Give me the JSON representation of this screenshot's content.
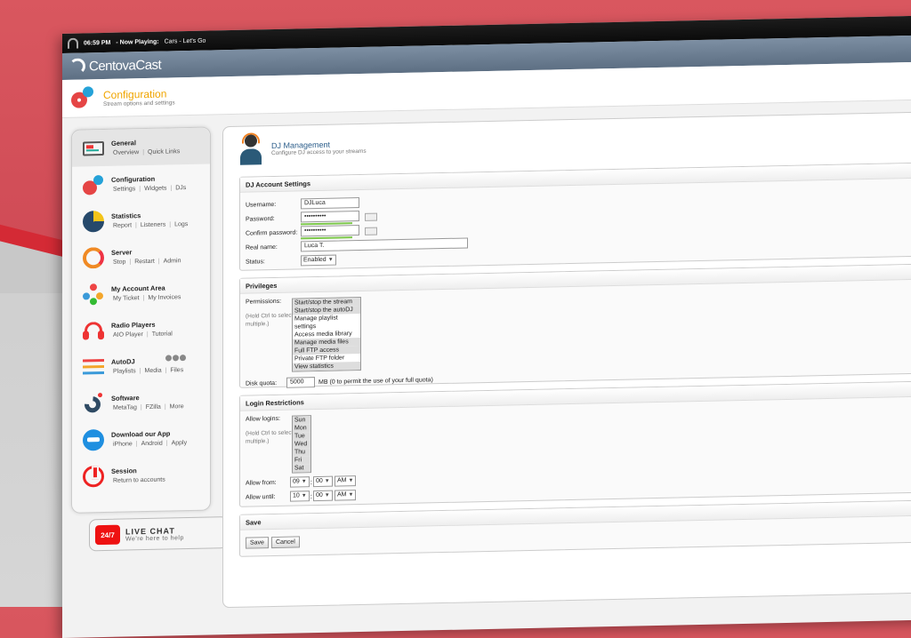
{
  "topbar": {
    "time": "06:59 PM",
    "now_playing_label": "- Now Playing:",
    "song": "Cars - Let's Go"
  },
  "brand": {
    "name": "CentovaCast"
  },
  "page": {
    "title": "Configuration",
    "subtitle": "Stream options and settings"
  },
  "sidebar": {
    "items": [
      {
        "title": "General",
        "links": [
          "Overview",
          "Quick Links"
        ],
        "icon": "monitor-icon"
      },
      {
        "title": "Configuration",
        "links": [
          "Settings",
          "Widgets",
          "DJs"
        ],
        "icon": "gears-icon"
      },
      {
        "title": "Statistics",
        "links": [
          "Report",
          "Listeners",
          "Logs"
        ],
        "icon": "pie-chart-icon"
      },
      {
        "title": "Server",
        "links": [
          "Stop",
          "Restart",
          "Admin"
        ],
        "icon": "refresh-icon"
      },
      {
        "title": "My Account Area",
        "links": [
          "My Ticket",
          "My Invoices"
        ],
        "icon": "users-icon"
      },
      {
        "title": "Radio Players",
        "links": [
          "AIO Player",
          "Tutorial"
        ],
        "icon": "headphones-icon"
      },
      {
        "title": "AutoDJ",
        "links": [
          "Playlists",
          "Media",
          "Files"
        ],
        "icon": "sliders-icon"
      },
      {
        "title": "Software",
        "links": [
          "MetaTag",
          "FZilla",
          "More"
        ],
        "icon": "magnet-icon"
      },
      {
        "title": "Download our App",
        "links": [
          "iPhone",
          "Android",
          "Apply"
        ],
        "icon": "app-icon"
      },
      {
        "title": "Session",
        "links": [
          "Return to accounts"
        ],
        "icon": "power-icon"
      }
    ]
  },
  "livechat": {
    "title": "LIVE CHAT",
    "subtitle": "We're here to help",
    "badge": "24/7"
  },
  "main": {
    "title": "DJ Management",
    "subtitle": "Configure DJ access to your streams"
  },
  "account": {
    "heading": "DJ Account Settings",
    "username_label": "Username:",
    "username": "DJLuca",
    "password_label": "Password:",
    "password": "••••••••••",
    "confirm_label": "Confirm password:",
    "confirm": "••••••••••",
    "realname_label": "Real name:",
    "realname": "Luca T.",
    "status_label": "Status:",
    "status": "Enabled"
  },
  "privileges": {
    "heading": "Privileges",
    "permissions_label": "Permissions:",
    "hint": "(Hold Ctrl to select multiple.)",
    "options": [
      "Start/stop the stream",
      "Start/stop the autoDJ",
      "Manage playlist settings",
      "Access media library",
      "Manage media files",
      "Full FTP access",
      "Private FTP folder",
      "View statistics"
    ],
    "disk_label": "Disk quota:",
    "disk_value": "5000",
    "disk_note": "MB (0 to permit the use of your full quota)"
  },
  "login": {
    "heading": "Login Restrictions",
    "allow_label": "Allow logins:",
    "hint": "(Hold Ctrl to select multiple.)",
    "days": [
      "Sun",
      "Mon",
      "Tue",
      "Wed",
      "Thu",
      "Fri",
      "Sat"
    ],
    "from_label": "Allow from:",
    "from_hour": "09",
    "from_min": "00",
    "from_ampm": "AM",
    "until_label": "Allow until:",
    "until_hour": "10",
    "until_min": "00",
    "until_ampm": "AM"
  },
  "save": {
    "heading": "Save",
    "save_label": "Save",
    "cancel_label": "Cancel"
  },
  "colors": {
    "accent": "#f0a500",
    "link": "#2b5d8a",
    "background": "#d9575f"
  }
}
